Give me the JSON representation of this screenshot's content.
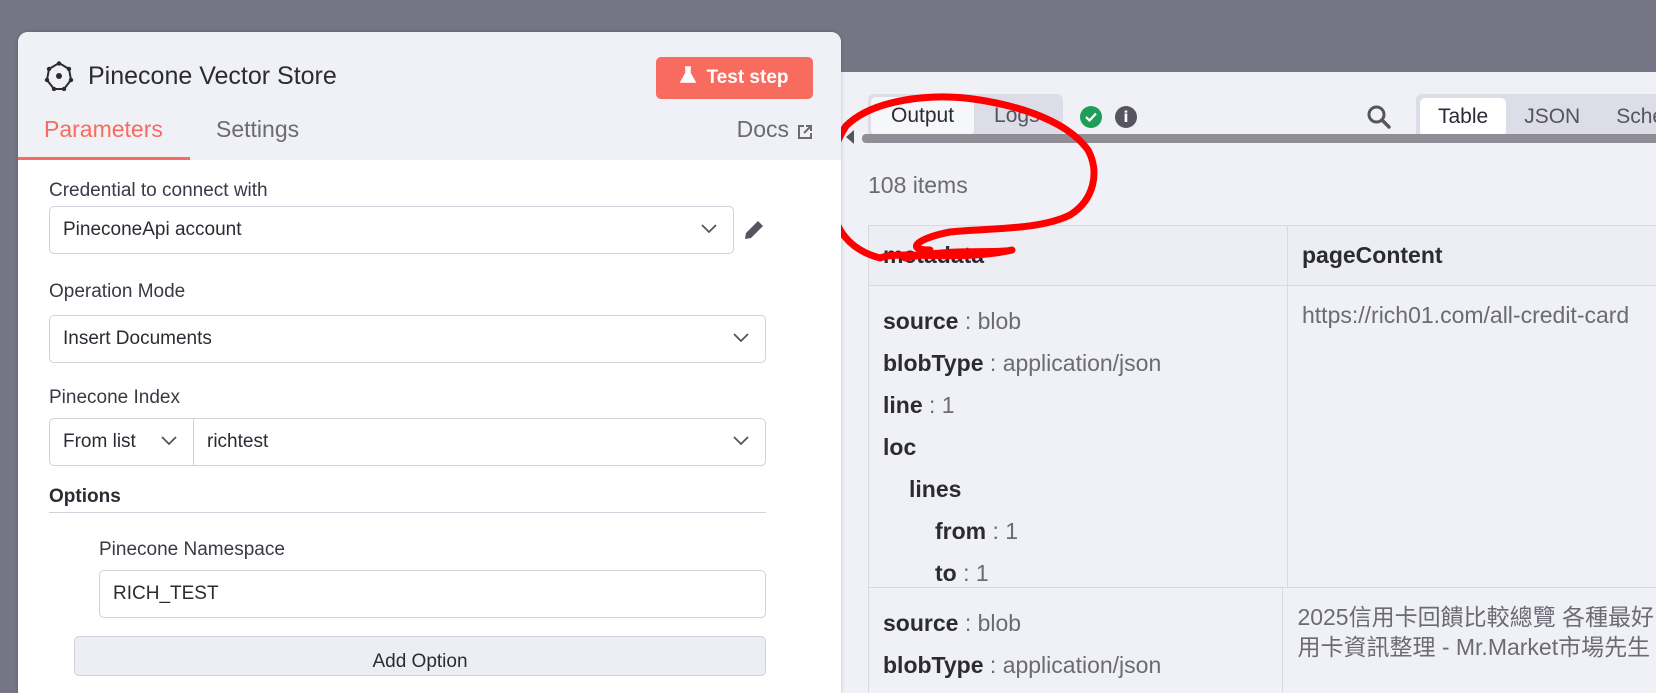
{
  "node": {
    "title": "Pinecone Vector Store",
    "test_label": "Test step",
    "accent": "#f76c5e"
  },
  "tabs": [
    {
      "label": "Parameters",
      "active": true
    },
    {
      "label": "Settings",
      "active": false
    }
  ],
  "docs_label": "Docs",
  "form": {
    "credential_label": "Credential to connect with",
    "credential_value": "PineconeApi account",
    "operation_label": "Operation Mode",
    "operation_value": "Insert Documents",
    "index_label": "Pinecone Index",
    "index_mode": "From list",
    "index_value": "richtest",
    "options_label": "Options",
    "namespace_label": "Pinecone Namespace",
    "namespace_value": "RICH_TEST",
    "add_option_label": "Add Option"
  },
  "output": {
    "tabs": [
      {
        "label": "Output",
        "active": true
      },
      {
        "label": "Logs",
        "active": false
      }
    ],
    "view_tabs": [
      {
        "label": "Table",
        "active": true
      },
      {
        "label": "JSON",
        "active": false
      },
      {
        "label": "Schema",
        "active": false
      }
    ],
    "item_count": "108 items",
    "columns": [
      "metadata",
      "pageContent"
    ],
    "rows": [
      {
        "metadata": {
          "source": "blob",
          "blobType": "application/json",
          "line": "1",
          "loc": "loc",
          "lines": "lines",
          "from": "1",
          "to": "1"
        },
        "pageContent": "https://rich01.com/all-credit-card"
      },
      {
        "metadata": {
          "source": "blob",
          "blobType": "application/json"
        },
        "pageContent_line1": "2025信用卡回饋比較總覽 各種最好",
        "pageContent_line2": "用卡資訊整理 - Mr.Market市場先生"
      }
    ],
    "sep": ":",
    "keys": {
      "source": "source",
      "blobType": "blobType",
      "line": "line",
      "from": "from",
      "to": "to"
    }
  },
  "icons": {
    "node": "pinecone-icon",
    "flask": "flask-icon",
    "external": "external-link-icon",
    "pencil": "pencil-icon",
    "success": "check-circle-icon",
    "info": "info-icon",
    "search": "search-icon"
  },
  "colors": {
    "success": "#1f9e5a",
    "annotation": "#ff0000"
  }
}
